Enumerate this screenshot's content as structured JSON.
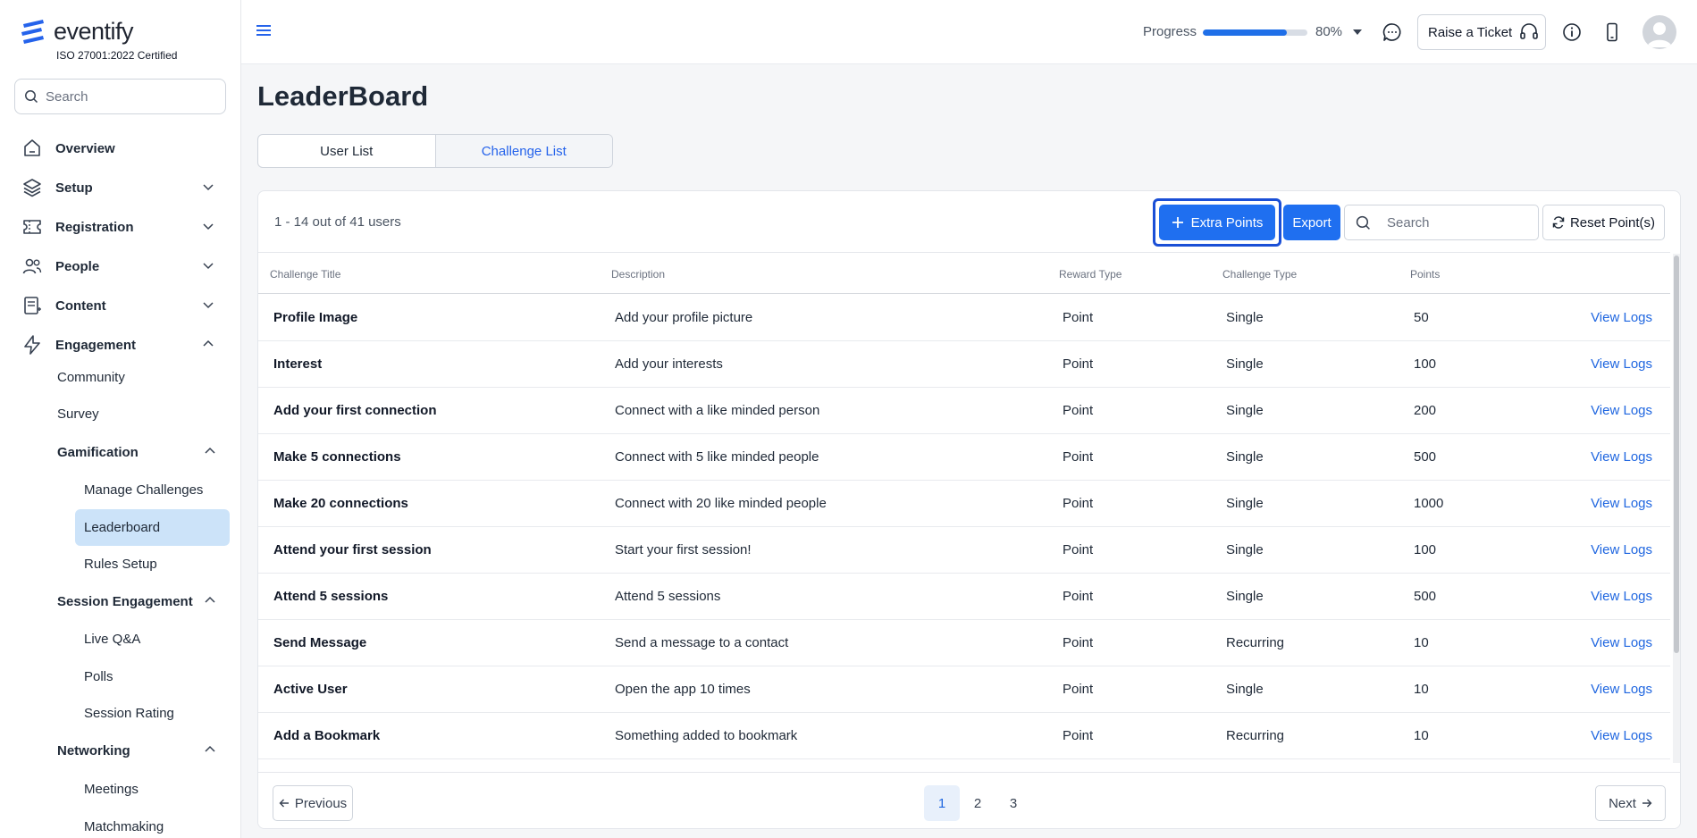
{
  "brand": {
    "name": "eventify",
    "certification": "ISO 27001:2022 Certified"
  },
  "sidebar": {
    "search_placeholder": "Search",
    "items": [
      {
        "label": "Overview",
        "icon": "home-icon"
      },
      {
        "label": "Setup",
        "icon": "layers-icon"
      },
      {
        "label": "Registration",
        "icon": "ticket-icon"
      },
      {
        "label": "People",
        "icon": "users-icon"
      },
      {
        "label": "Content",
        "icon": "document-icon"
      },
      {
        "label": "Engagement",
        "icon": "lightning-icon"
      }
    ],
    "engagement": {
      "community": "Community",
      "survey": "Survey",
      "gamification": "Gamification",
      "manage_challenges": "Manage Challenges",
      "leaderboard": "Leaderboard",
      "rules_setup": "Rules Setup",
      "session_engagement": "Session Engagement",
      "live_qa": "Live Q&A",
      "polls": "Polls",
      "session_rating": "Session Rating",
      "networking": "Networking",
      "meetings": "Meetings",
      "matchmaking": "Matchmaking"
    }
  },
  "topbar": {
    "progress_label": "Progress",
    "progress_value": 80,
    "progress_text": "80%",
    "ticket_label": "Raise a Ticket"
  },
  "main": {
    "title": "LeaderBoard",
    "tabs": [
      {
        "label": "User List"
      },
      {
        "label": "Challenge List"
      }
    ],
    "count_text": "1 - 14 out of 41 users",
    "extra_points_label": "Extra Points",
    "export_label": "Export",
    "search_placeholder": "Search",
    "reset_label": "Reset Point(s)",
    "columns": [
      "Challenge Title",
      "Description",
      "Reward Type",
      "Challenge Type",
      "Points"
    ],
    "rows": [
      {
        "title": "Profile Image",
        "description": "Add your profile picture",
        "reward": "Point",
        "type": "Single",
        "points": "50",
        "action": "View Logs"
      },
      {
        "title": "Interest",
        "description": "Add your interests",
        "reward": "Point",
        "type": "Single",
        "points": "100",
        "action": "View Logs"
      },
      {
        "title": "Add your first connection",
        "description": "Connect with a like minded person",
        "reward": "Point",
        "type": "Single",
        "points": "200",
        "action": "View Logs"
      },
      {
        "title": "Make 5 connections",
        "description": "Connect with 5 like minded people",
        "reward": "Point",
        "type": "Single",
        "points": "500",
        "action": "View Logs"
      },
      {
        "title": "Make 20 connections",
        "description": "Connect with 20 like minded people",
        "reward": "Point",
        "type": "Single",
        "points": "1000",
        "action": "View Logs"
      },
      {
        "title": "Attend your first session",
        "description": "Start your first session!",
        "reward": "Point",
        "type": "Single",
        "points": "100",
        "action": "View Logs"
      },
      {
        "title": "Attend 5 sessions",
        "description": "Attend 5 sessions",
        "reward": "Point",
        "type": "Single",
        "points": "500",
        "action": "View Logs"
      },
      {
        "title": "Send Message",
        "description": "Send a message to a contact",
        "reward": "Point",
        "type": "Recurring",
        "points": "10",
        "action": "View Logs"
      },
      {
        "title": "Active User",
        "description": "Open the app 10 times",
        "reward": "Point",
        "type": "Single",
        "points": "10",
        "action": "View Logs"
      },
      {
        "title": "Add a Bookmark",
        "description": "Something added to bookmark",
        "reward": "Point",
        "type": "Recurring",
        "points": "10",
        "action": "View Logs"
      }
    ],
    "pagination": {
      "previous": "Previous",
      "next": "Next",
      "pages": [
        "1",
        "2",
        "3"
      ],
      "current": "1"
    }
  },
  "colors": {
    "accent": "#1f6ff0",
    "link": "#1f66e0",
    "active_nav": "#cce3f9"
  }
}
